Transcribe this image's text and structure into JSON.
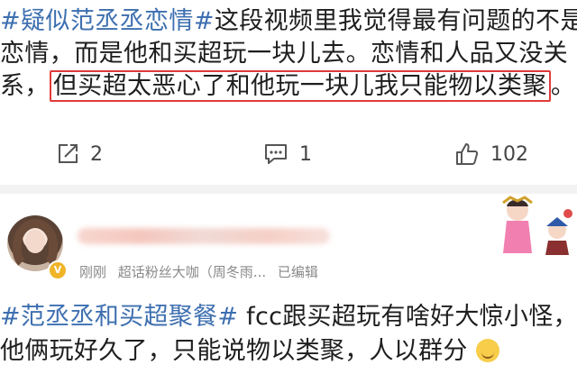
{
  "post1": {
    "hashtag": "#疑似范丞丞恋情#",
    "line1_rest": "这段视频里我觉得最有问题的不是",
    "line2": "恋情，而是他和买超玩一块儿去。恋情和人品又没关",
    "line3_prefix": "系，",
    "highlighted": "但买超太恶心了和他玩一块儿我只能物以类聚",
    "line3_suffix": "。"
  },
  "actions": {
    "repost_icon": "share-icon",
    "repost_count": "2",
    "comment_icon": "comment-icon",
    "comment_count": "1",
    "like_icon": "thumbs-up-icon",
    "like_count": "102"
  },
  "post2": {
    "meta_time": "刚刚",
    "meta_title": "超话粉丝大咖（周冬雨...",
    "meta_edited": "已编辑",
    "hashtag": "#范丞丞和买超聚餐#",
    "line1_rest": " fcc跟买超玩有啥好大惊小怪，",
    "line2": "他俩玩好久了，只能说物以类聚，人以群分",
    "emoji": "shush-face-emoji",
    "badge_icon": "vip-badge-icon"
  },
  "colors": {
    "hashtag": "#3d6fb0",
    "highlight_border": "#e03a3a",
    "meta_gray": "#8a8a8a"
  }
}
